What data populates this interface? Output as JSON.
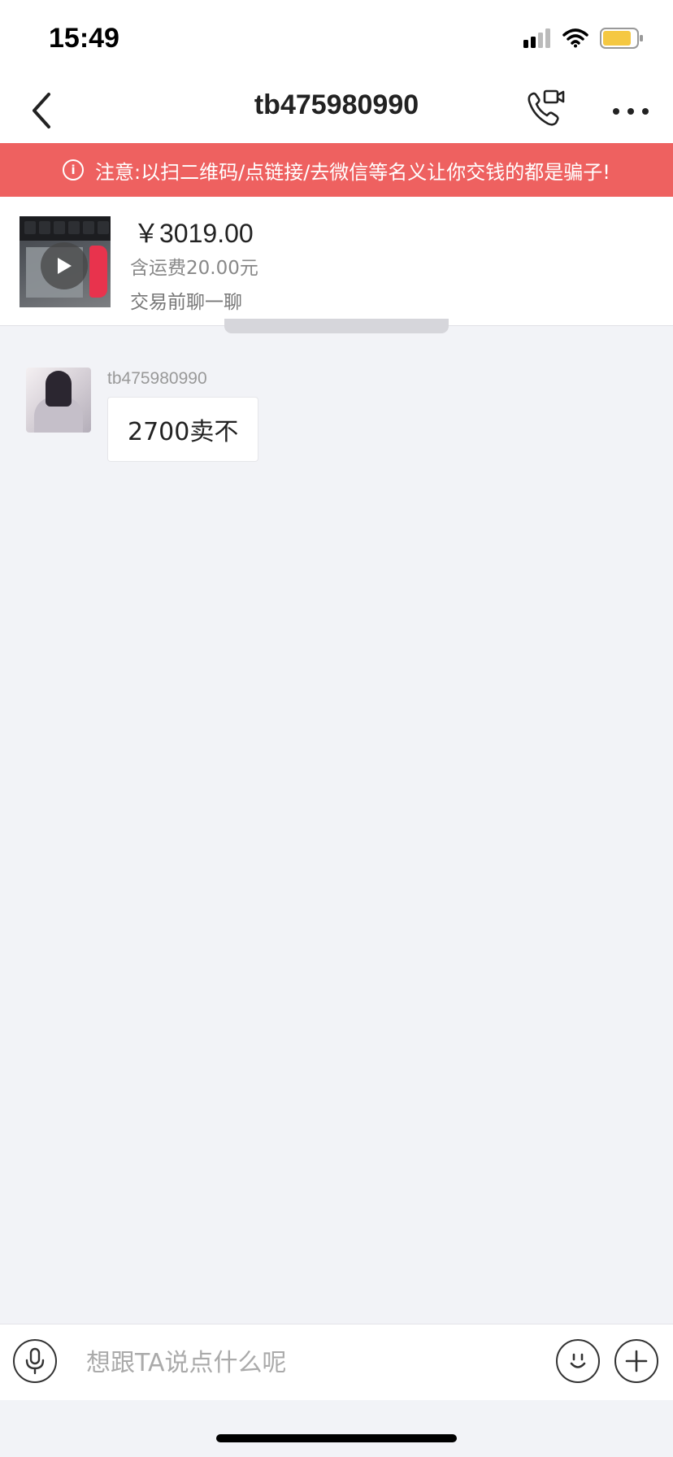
{
  "status_bar": {
    "time": "15:49"
  },
  "nav": {
    "title": "tb475980990"
  },
  "warning": {
    "text": "注意:以扫二维码/点链接/去微信等名义让你交钱的都是骗子!"
  },
  "product": {
    "price": "￥3019.00",
    "shipping": "含运费20.00元",
    "chat_prompt": "交易前聊一聊"
  },
  "messages": [
    {
      "sender": "tb475980990",
      "text": "2700卖不"
    }
  ],
  "input": {
    "placeholder": "想跟TA说点什么呢"
  },
  "colors": {
    "warning_bg": "#ee6160",
    "chat_bg": "#f2f3f7",
    "battery": "#f5c842"
  },
  "icons": [
    "back-arrow-icon",
    "video-call-icon",
    "more-icon",
    "info-icon",
    "play-icon",
    "microphone-icon",
    "emoji-icon",
    "plus-icon",
    "cellular-signal-icon",
    "wifi-icon",
    "battery-icon"
  ]
}
